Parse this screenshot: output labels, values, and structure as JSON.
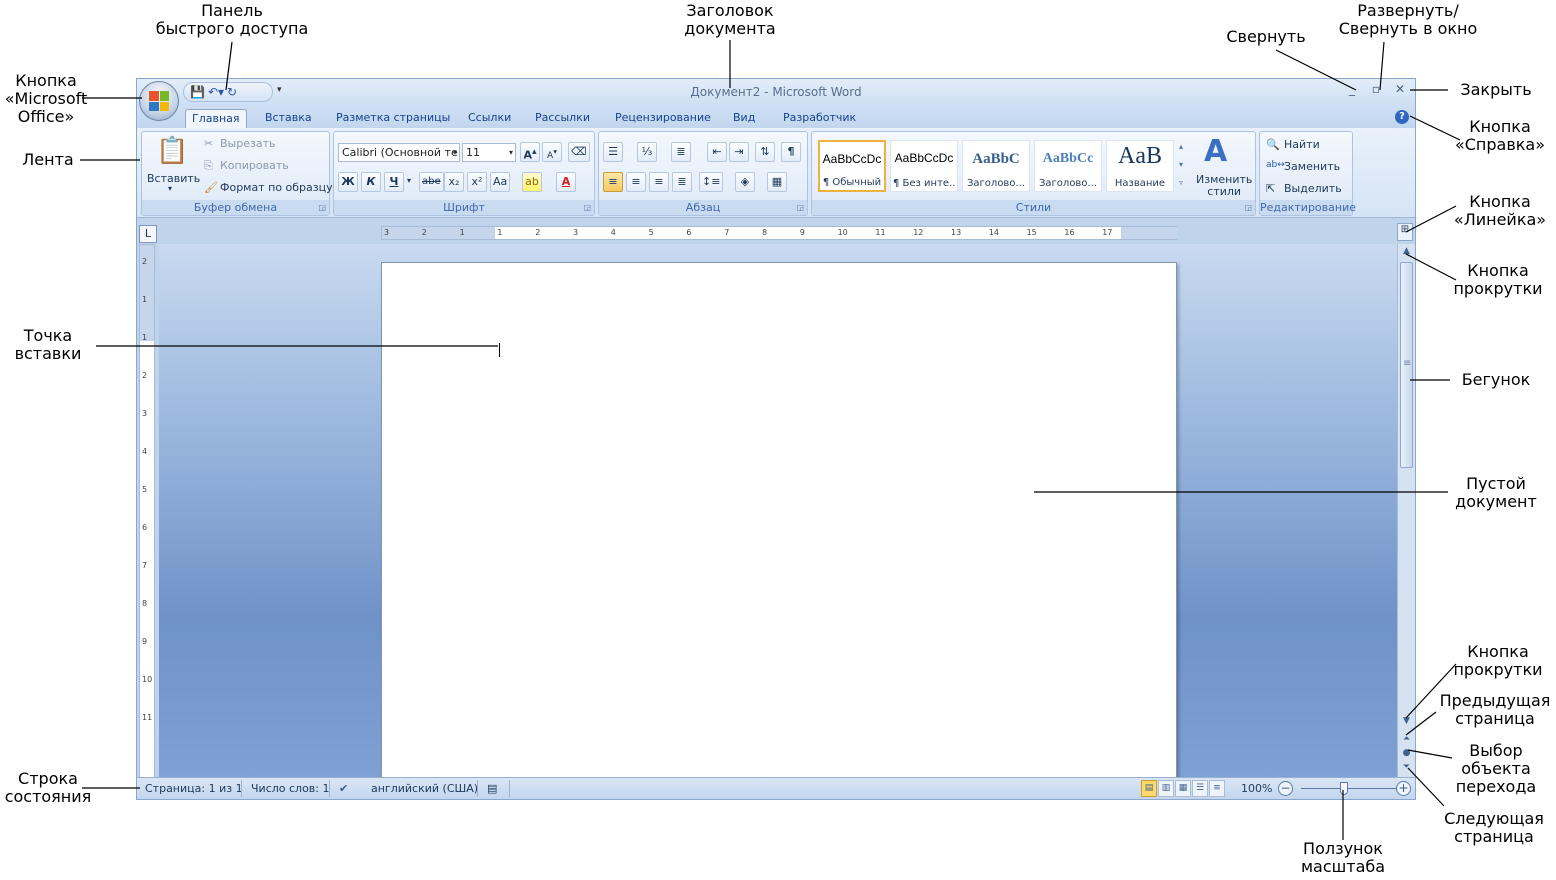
{
  "annotations": {
    "quick_access": "Панель\nбыстрого доступа",
    "doc_title": "Заголовок\nдокумента",
    "minimize": "Свернуть",
    "maximize_restore": "Развернуть/\nСвернуть в окно",
    "office_button": "Кнопка\n«Microsoft\nOffice»",
    "close": "Закрыть",
    "ribbon": "Лента",
    "help_button": "Кнопка\n«Справка»",
    "ruler_button": "Кнопка\n«Линейка»",
    "scroll_button_top": "Кнопка\nпрокрутки",
    "insertion_point": "Точка\nвставки",
    "scroll_thumb": "Бегунок",
    "empty_document": "Пустой\nдокумент",
    "scroll_button_bottom": "Кнопка\nпрокрутки",
    "previous_page": "Предыдущая\nстраница",
    "browse_object": "Выбор\nобъекта\nперехода",
    "status_bar": "Строка\nсостояния",
    "next_page": "Следующая\nстраница",
    "zoom_slider": "Ползунок\nмасштаба"
  },
  "window": {
    "title": "Документ2 - Microsoft Word",
    "controls": {
      "minimize": "_",
      "restore": "▫",
      "close": "✕"
    }
  },
  "tabs": [
    "Главная",
    "Вставка",
    "Разметка страницы",
    "Ссылки",
    "Рассылки",
    "Рецензирование",
    "Вид",
    "Разработчик"
  ],
  "ribbon": {
    "clipboard": {
      "label": "Буфер обмена",
      "paste": "Вставить",
      "cut": "Вырезать",
      "copy": "Копировать",
      "format_painter": "Формат по образцу"
    },
    "font": {
      "label": "Шрифт",
      "font_name": "Calibri (Основной те",
      "font_size": "11",
      "bold": "Ж",
      "italic": "К",
      "underline": "Ч",
      "strike": "abe",
      "subscript": "x₂",
      "superscript": "x²",
      "case": "Aa",
      "grow": "A",
      "shrink": "A"
    },
    "paragraph": {
      "label": "Абзац",
      "pilcrow": "¶"
    },
    "styles": {
      "label": "Стили",
      "tiles": [
        {
          "sample": "AaBbCcDc",
          "name": "¶ Обычный"
        },
        {
          "sample": "AaBbCcDc",
          "name": "¶ Без инте..."
        },
        {
          "sample": "AaBbC",
          "name": "Заголово..."
        },
        {
          "sample": "AaBbCc",
          "name": "Заголово..."
        },
        {
          "sample": "AaB",
          "name": "Название"
        }
      ],
      "change_styles": "Изменить\nстили"
    },
    "editing": {
      "label": "Редактирование",
      "find": "Найти",
      "replace": "Заменить",
      "select": "Выделить"
    }
  },
  "ruler": {
    "h_ticks": [
      "3",
      "2",
      "1",
      "1",
      "2",
      "3",
      "4",
      "5",
      "6",
      "7",
      "8",
      "9",
      "10",
      "11",
      "12",
      "13",
      "14",
      "15",
      "16",
      "17"
    ],
    "v_ticks": [
      "2",
      "1",
      "1",
      "2",
      "3",
      "4",
      "5",
      "6",
      "7",
      "8",
      "9",
      "10",
      "11"
    ]
  },
  "statusbar": {
    "page": "Страница: 1 из 1",
    "words": "Число слов: 1",
    "language": "английский (США)",
    "zoom": "100%"
  }
}
